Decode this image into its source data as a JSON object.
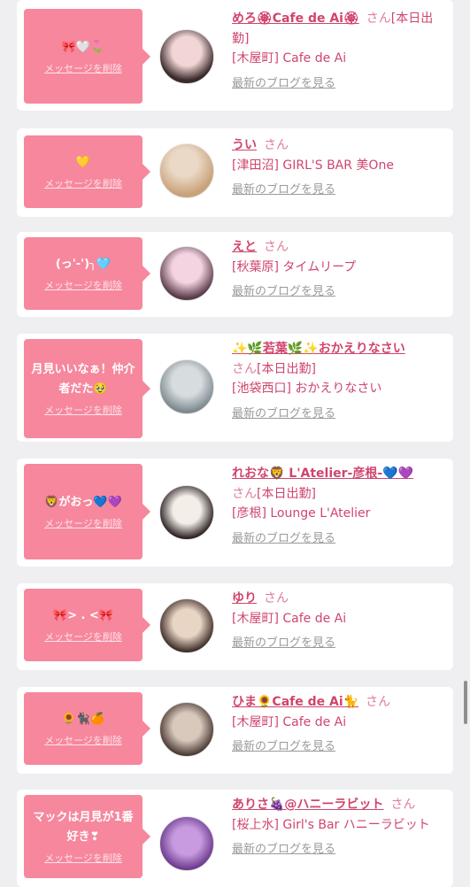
{
  "conversations": [
    {
      "message": "🎀🤍🌷",
      "delete_label": "メッセージを削除",
      "name": "めろ🏵Cafe de Ai🏵",
      "honorific": "さん",
      "today": "[本日出勤]",
      "shop": "[木屋町] Cafe de Ai",
      "blog_label": "最新のブログを見る",
      "avatar_colors": [
        "#f2d6d6",
        "#3a2a2a"
      ]
    },
    {
      "message": "💛",
      "delete_label": "メッセージを削除",
      "name": "うい",
      "honorific": "さん",
      "today": "",
      "shop": "[津田沼] GIRL'S BAR 美One",
      "blog_label": "最新のブログを見る",
      "avatar_colors": [
        "#ead9c6",
        "#c9a27a"
      ]
    },
    {
      "message": "(っ'-')╮🩵",
      "delete_label": "メッセージを削除",
      "name": "えと",
      "honorific": "さん",
      "today": "",
      "shop": "[秋葉原] タイムリープ",
      "blog_label": "最新のブログを見る",
      "avatar_colors": [
        "#f5d4e2",
        "#5a3b4a"
      ]
    },
    {
      "message": "月見いいなぁ！仲介者だた🥹",
      "delete_label": "メッセージを削除",
      "name": "✨🌿若葉🌿✨おかえりなさい",
      "honorific": "さん",
      "today": "[本日出勤]",
      "shop": "[池袋西口] おかえりなさい",
      "blog_label": "最新のブログを見る",
      "avatar_colors": [
        "#d7dcdf",
        "#7e8a90"
      ]
    },
    {
      "message": "🦁がおっ💙💜",
      "delete_label": "メッセージを削除",
      "name": "れおな🦁 L'Atelier-彦根-💙💜",
      "honorific": "さん",
      "today": "[本日出勤]",
      "shop": "[彦根] Lounge L'Atelier",
      "blog_label": "最新のブログを見る",
      "avatar_colors": [
        "#f4eee9",
        "#2a2020"
      ]
    },
    {
      "message": "🎀> . <🎀",
      "delete_label": "メッセージを削除",
      "name": "ゆり",
      "honorific": "さん",
      "today": "",
      "shop": "[木屋町] Cafe de Ai",
      "blog_label": "最新のブログを見る",
      "avatar_colors": [
        "#e9d5c4",
        "#3d2c28"
      ]
    },
    {
      "message": "🌻🐈‍⬛🍊",
      "delete_label": "メッセージを削除",
      "name": "ひま🌻Cafe de Ai🐈",
      "honorific": "さん",
      "today": "",
      "shop": "[木屋町] Cafe de Ai",
      "blog_label": "最新のブログを見る",
      "avatar_colors": [
        "#d9c9bd",
        "#4a3a33"
      ]
    },
    {
      "message": "マックは月見が1番好き❣",
      "delete_label": "メッセージを削除",
      "name": "ありさ🍇@ハニーラビット",
      "honorific": "さん",
      "today": "",
      "shop": "[桜上水] Girl's Bar ハニーラビット",
      "blog_label": "最新のブログを見る",
      "avatar_colors": [
        "#c89be0",
        "#6b3a8c"
      ]
    }
  ]
}
